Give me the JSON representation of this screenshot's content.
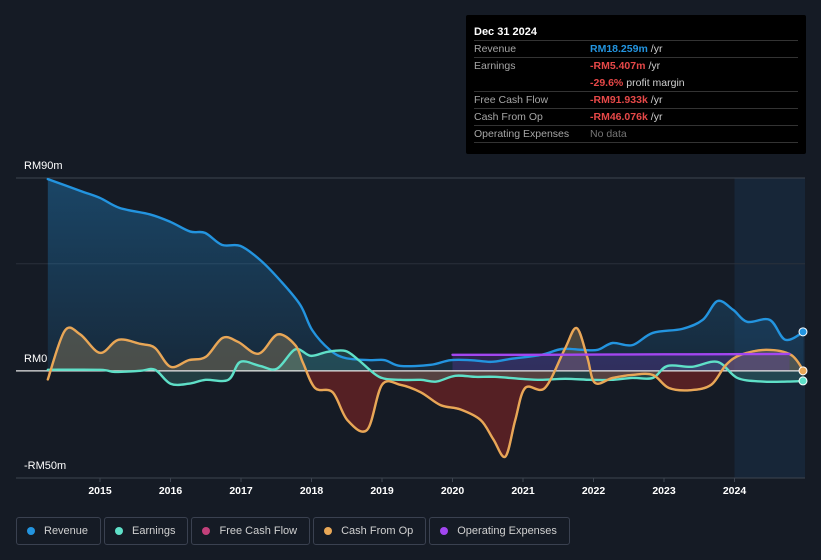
{
  "tooltip": {
    "date": "Dec 31 2024",
    "rows": [
      {
        "label": "Revenue",
        "value": "RM18.259m",
        "unit": "/yr",
        "tone": "blue"
      },
      {
        "label": "Earnings",
        "value": "-RM5.407m",
        "unit": "/yr",
        "tone": "red"
      },
      {
        "label": "",
        "value": "-29.6%",
        "unit": "profit margin",
        "tone": "red"
      },
      {
        "label": "Free Cash Flow",
        "value": "-RM91.933k",
        "unit": "/yr",
        "tone": "red"
      },
      {
        "label": "Cash From Op",
        "value": "-RM46.076k",
        "unit": "/yr",
        "tone": "red"
      },
      {
        "label": "Operating Expenses",
        "value": "No data",
        "unit": "",
        "tone": "grey"
      }
    ]
  },
  "colors": {
    "revenue": "#2394df",
    "earnings": "#5fe0c8",
    "free_cash_flow": "#c2407a",
    "cash_from_op": "#e8a756",
    "operating_expenses": "#a246f0"
  },
  "chart_data": {
    "type": "line",
    "title": "",
    "xlabel": "",
    "ylabel": "",
    "ylim": [
      -50,
      90
    ],
    "xlim": [
      2014.25,
      2025.0
    ],
    "y_tick_labels": [
      "RM90m",
      "RM0",
      "-RM50m"
    ],
    "y_ticks": [
      90,
      0,
      -50
    ],
    "x_ticks": [
      2015,
      2016,
      2017,
      2018,
      2019,
      2020,
      2021,
      2022,
      2023,
      2024
    ],
    "x_tick_labels": [
      "2015",
      "2016",
      "2017",
      "2018",
      "2019",
      "2020",
      "2021",
      "2022",
      "2023",
      "2024"
    ],
    "highlight_range": [
      2024.0,
      2025.0
    ],
    "grid": true,
    "legend_position": "bottom",
    "series": [
      {
        "name": "Revenue",
        "key": "revenue",
        "unit": "RM m",
        "x": [
          2014.26,
          2014.72,
          2015.0,
          2015.28,
          2015.71,
          2016.0,
          2016.28,
          2016.49,
          2016.73,
          2016.99,
          2017.27,
          2017.55,
          2017.84,
          2018.01,
          2018.26,
          2018.48,
          2018.83,
          2019.04,
          2019.26,
          2019.69,
          2019.97,
          2020.26,
          2020.55,
          2020.83,
          2021.26,
          2021.55,
          2021.84,
          2022.06,
          2022.27,
          2022.55,
          2022.84,
          2023.26,
          2023.55,
          2023.76,
          2023.98,
          2024.18,
          2024.5,
          2024.72,
          2024.98
        ],
        "values": [
          89.5,
          84,
          80.7,
          76,
          73,
          69.5,
          65,
          64.4,
          58.8,
          58.3,
          51.8,
          42.4,
          30.8,
          19,
          9.8,
          6,
          5,
          5,
          2.3,
          2.8,
          5,
          5,
          4.2,
          5.6,
          7.5,
          10.2,
          9.8,
          9.8,
          13,
          12,
          17.7,
          19.6,
          23.8,
          32.6,
          28.5,
          22.9,
          23.8,
          14.5,
          18.2
        ]
      },
      {
        "name": "Earnings",
        "key": "earnings",
        "unit": "RM m",
        "x": [
          2014.26,
          2015.0,
          2015.21,
          2015.57,
          2015.78,
          2016.0,
          2016.26,
          2016.5,
          2016.82,
          2016.99,
          2017.27,
          2017.51,
          2017.77,
          2017.99,
          2018.23,
          2018.48,
          2018.67,
          2018.96,
          2019.26,
          2019.55,
          2019.77,
          2020.04,
          2020.32,
          2020.6,
          2020.96,
          2021.25,
          2021.6,
          2021.96,
          2022.25,
          2022.55,
          2022.84,
          2023.05,
          2023.4,
          2023.76,
          2024.04,
          2024.4,
          2024.75,
          2024.98
        ],
        "values": [
          0.5,
          0.5,
          -0.5,
          0,
          0.5,
          -6,
          -6,
          -4.2,
          -4.2,
          4.2,
          2.3,
          1,
          10,
          7,
          8.9,
          9.3,
          5,
          -2.8,
          -4.2,
          -4.2,
          -5,
          -2.3,
          -2.8,
          -2.8,
          -3.7,
          -4.2,
          -3.7,
          -4.2,
          -4.2,
          -3.3,
          -3.3,
          2.3,
          1.9,
          4.2,
          -3.3,
          -5,
          -5,
          -4.7
        ]
      },
      {
        "name": "Free Cash Flow",
        "key": "free_cash_flow",
        "unit": "RM m",
        "x": [
          2014.26,
          2014.5,
          2014.72,
          2015.0,
          2015.26,
          2015.57,
          2015.78,
          2016.0,
          2016.26,
          2016.5,
          2016.74,
          2016.96,
          2017.25,
          2017.52,
          2017.77,
          2017.88,
          2018.05,
          2018.3,
          2018.51,
          2018.79,
          2019.0,
          2019.26,
          2019.55,
          2019.83,
          2020.11,
          2020.4,
          2020.58,
          2020.75,
          2020.89,
          2021.03,
          2021.31,
          2021.59,
          2021.76,
          2021.91,
          2022.02,
          2022.27,
          2022.55,
          2022.84,
          2023.07,
          2023.38,
          2023.67,
          2023.88,
          2024.09,
          2024.45,
          2024.8,
          2024.98
        ],
        "values": [
          -4,
          18.7,
          17,
          8.4,
          14.5,
          12.6,
          10.7,
          1.9,
          5,
          6.5,
          15.4,
          13.5,
          8,
          17,
          12,
          3.7,
          -8,
          -10,
          -23,
          -27.5,
          -6.5,
          -6.5,
          -10,
          -16,
          -18,
          -23,
          -32,
          -40,
          -23,
          -8,
          -8,
          10,
          20,
          6.5,
          -5.6,
          -3.3,
          -1.9,
          -1.9,
          -8,
          -9,
          -6.5,
          2.8,
          7.5,
          9.8,
          7.5,
          -0.1
        ]
      },
      {
        "name": "Cash From Op",
        "key": "cash_from_op",
        "unit": "RM m",
        "x": [
          2014.26,
          2014.5,
          2014.72,
          2015.0,
          2015.26,
          2015.57,
          2015.78,
          2016.0,
          2016.26,
          2016.5,
          2016.74,
          2016.96,
          2017.25,
          2017.52,
          2017.77,
          2017.88,
          2018.05,
          2018.3,
          2018.51,
          2018.79,
          2019.0,
          2019.26,
          2019.55,
          2019.83,
          2020.11,
          2020.4,
          2020.58,
          2020.75,
          2020.89,
          2021.03,
          2021.31,
          2021.59,
          2021.76,
          2021.91,
          2022.02,
          2022.27,
          2022.55,
          2022.84,
          2023.07,
          2023.38,
          2023.67,
          2023.88,
          2024.09,
          2024.45,
          2024.8,
          2024.98
        ],
        "values": [
          -4,
          18.7,
          17,
          8.4,
          14.5,
          12.6,
          10.7,
          1.9,
          5,
          6.5,
          15.4,
          13.5,
          8,
          17,
          12,
          3.7,
          -8,
          -10,
          -23,
          -27.5,
          -6.5,
          -6.5,
          -10,
          -16,
          -18,
          -23,
          -32,
          -40,
          -23,
          -8,
          -8,
          10,
          20,
          6.5,
          -5.6,
          -3.3,
          -1.9,
          -1.9,
          -8,
          -9,
          -6.5,
          2.8,
          7.5,
          9.8,
          7.5,
          0
        ]
      },
      {
        "name": "Operating Expenses",
        "key": "operating_expenses",
        "unit": "RM m",
        "x": [
          2020.0,
          2021.0,
          2022.0,
          2023.0,
          2024.0,
          2024.78
        ],
        "values": [
          7.5,
          7.5,
          7.6,
          7.7,
          7.8,
          7.9
        ]
      }
    ]
  },
  "legend": [
    {
      "label": "Revenue",
      "key": "revenue"
    },
    {
      "label": "Earnings",
      "key": "earnings"
    },
    {
      "label": "Free Cash Flow",
      "key": "free_cash_flow"
    },
    {
      "label": "Cash From Op",
      "key": "cash_from_op"
    },
    {
      "label": "Operating Expenses",
      "key": "operating_expenses"
    }
  ]
}
